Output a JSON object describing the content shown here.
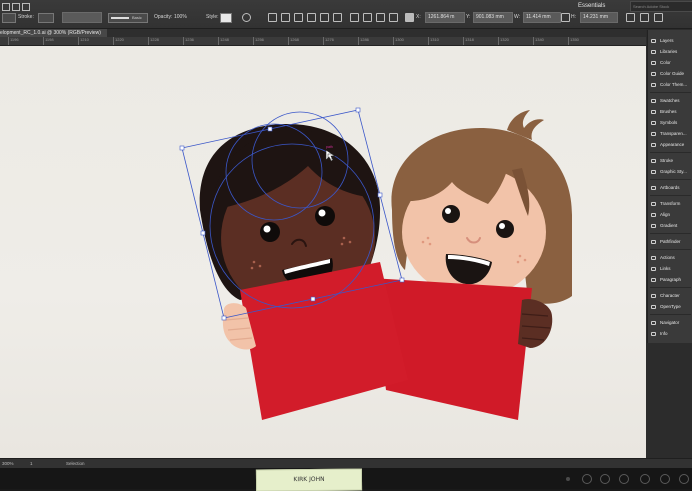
{
  "control_bar": {
    "stroke_label": "Stroke:",
    "brush_label": "Basic",
    "opacity_label": "Opacity:",
    "opacity_value": "100%",
    "style_label": "Style:",
    "x_label": "X:",
    "x_value": "1261.864 m",
    "y_label": "Y:",
    "y_value": "901.083 mm",
    "w_label": "W:",
    "w_value": "11.414 mm",
    "h_label": "H:",
    "h_value": "14.231 mm",
    "workspace": "Essentials",
    "search_placeholder": "Search Adobe Stock"
  },
  "document": {
    "tab_title": "elopment_RC_1.0.ai @ 300% (RGB/Preview)"
  },
  "ruler": {
    "ticks": [
      "1196",
      "1198",
      "1210",
      "1220",
      "1228",
      "1236",
      "1248",
      "1256",
      "1268",
      "1276",
      "1286",
      "1300",
      "1310",
      "1318",
      "1320",
      "1340",
      "1350"
    ]
  },
  "panels": [
    {
      "label": "Layers",
      "icon": "layers-icon"
    },
    {
      "label": "Libraries",
      "icon": "libraries-icon"
    },
    {
      "label": "Color",
      "icon": "color-icon"
    },
    {
      "label": "Color Guide",
      "icon": "color-guide-icon"
    },
    {
      "label": "Color Them...",
      "icon": "color-themes-icon"
    },
    {
      "label": "Swatches",
      "icon": "swatches-icon"
    },
    {
      "label": "Brushes",
      "icon": "brushes-icon"
    },
    {
      "label": "Symbols",
      "icon": "symbols-icon"
    },
    {
      "label": "Transparen...",
      "icon": "transparency-icon"
    },
    {
      "label": "Appearance",
      "icon": "appearance-icon"
    },
    {
      "label": "Stroke",
      "icon": "stroke-icon"
    },
    {
      "label": "Graphic Sty...",
      "icon": "graphic-styles-icon"
    },
    {
      "label": "Artboards",
      "icon": "artboards-icon"
    },
    {
      "label": "Transform",
      "icon": "transform-icon"
    },
    {
      "label": "Align",
      "icon": "align-icon"
    },
    {
      "label": "Gradient",
      "icon": "gradient-icon"
    },
    {
      "label": "Pathfinder",
      "icon": "pathfinder-icon"
    },
    {
      "label": "Actions",
      "icon": "actions-icon"
    },
    {
      "label": "Links",
      "icon": "links-icon"
    },
    {
      "label": "Paragraph",
      "icon": "paragraph-icon"
    },
    {
      "label": "Character",
      "icon": "character-icon"
    },
    {
      "label": "OpenType",
      "icon": "opentype-icon"
    },
    {
      "label": "Navigator",
      "icon": "navigator-icon"
    },
    {
      "label": "Info",
      "icon": "info-icon"
    }
  ],
  "status_bar": {
    "zoom": "300%",
    "page": "1",
    "tool": "Selection"
  },
  "sticky_note": "KIRK JOHN",
  "colors": {
    "shirt_red": "#d01a28",
    "skin_dark": "#5b2e23",
    "skin_light": "#f2c3a9",
    "hair_brown": "#8a6040",
    "hair_black": "#1e1412",
    "selection_blue": "#3b57c9"
  }
}
